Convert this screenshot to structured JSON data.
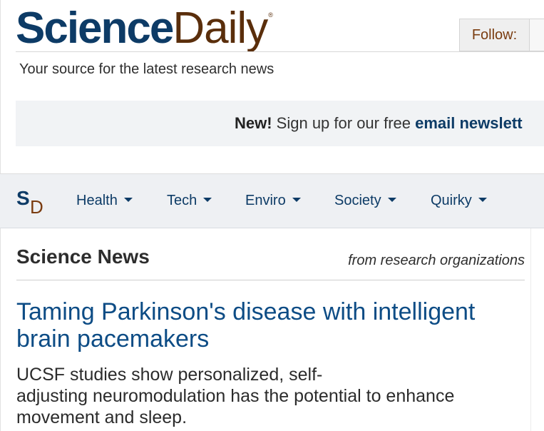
{
  "header": {
    "logo_part1": "Science",
    "logo_part2": "Daily",
    "logo_reg": "®",
    "tagline": "Your source for the latest research news",
    "follow_label": "Follow:"
  },
  "banner": {
    "new_label": "New!",
    "text": " Sign up for our free ",
    "link_text": "email newslett"
  },
  "nav": {
    "logo_s": "S",
    "logo_d": "D",
    "items": [
      {
        "label": "Health"
      },
      {
        "label": "Tech"
      },
      {
        "label": "Enviro"
      },
      {
        "label": "Society"
      },
      {
        "label": "Quirky"
      }
    ]
  },
  "content": {
    "section_title": "Science News",
    "section_subtitle": "from research organizations",
    "headline": "Taming Parkinson's disease with intelligent brain pacemakers",
    "summary_line1": "UCSF studies show personalized, self-",
    "summary_line2": "adjusting neuromodulation has the potential to enhance movement and sleep."
  },
  "colors": {
    "brand_blue": "#0d3b66",
    "brand_brown": "#5a2e0b",
    "headline_blue": "#0d4c85",
    "nav_bg": "#eef0f3"
  }
}
